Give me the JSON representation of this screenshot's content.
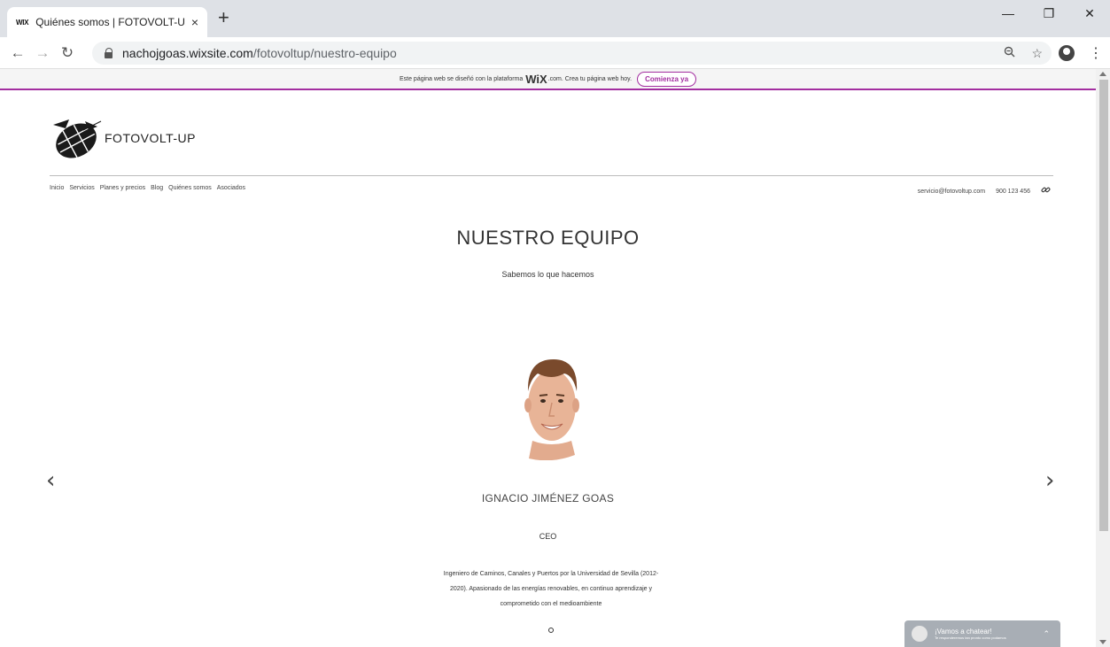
{
  "browser": {
    "tab_favicon": "WIX",
    "tab_title": "Quiénes somos | FOTOVOLT-UP",
    "tab_close": "×",
    "new_tab": "+",
    "url_host": "nachojgoas.wixsite.com",
    "url_path": "/fotovoltup/nuestro-equipo"
  },
  "wix_banner": {
    "text_before": "Este página web se diseñó con la plataforma",
    "logo": "WiX",
    "text_after": ".com. Crea tu página web hoy.",
    "cta": "Comienza ya"
  },
  "site": {
    "name": "FOTOVOLT-UP",
    "nav": [
      "Inicio",
      "Servicios",
      "Planes y precios",
      "Blog",
      "Quiénes somos",
      "Asociados"
    ],
    "email": "servicio@fotovoltup.com",
    "phone": "900 123 456"
  },
  "main": {
    "title": "NUESTRO EQUIPO",
    "subtitle": "Sabemos lo que hacemos",
    "member": {
      "name": "IGNACIO JIMÉNEZ GOAS",
      "role": "CEO",
      "bio_lines": [
        "Ingeniero de Caminos, Canales y Puertos por la Universidad de Sevilla (2012-",
        "2020). Apasionado de las energías renovables, en continuo aprendizaje y",
        "comprometido con el medioambiente"
      ]
    }
  },
  "chat": {
    "title": "¡Vamos a chatear!",
    "subtitle": "Te responderemos tan pronto como podamos"
  },
  "colors": {
    "wix_accent": "#a32ea0",
    "chat_bg": "#a8aeb5"
  }
}
